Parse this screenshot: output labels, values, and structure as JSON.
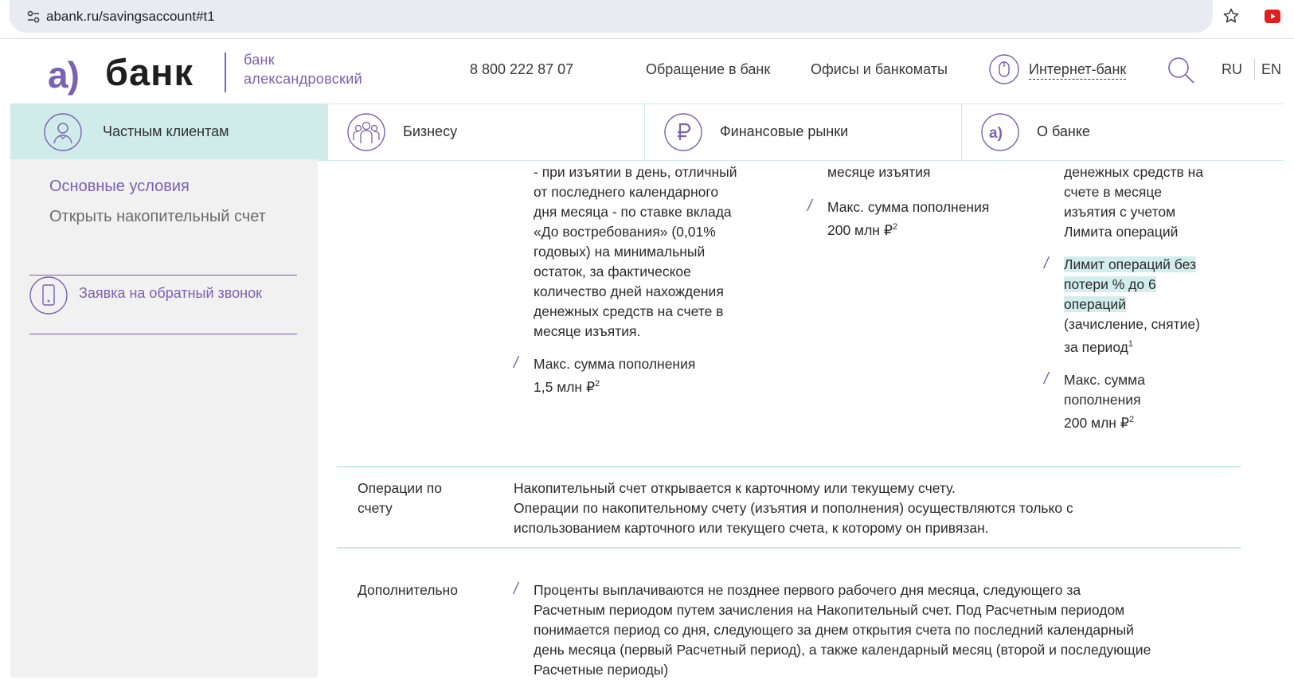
{
  "browser": {
    "url": "abank.ru/savingsaccount#t1"
  },
  "header": {
    "logo_mark": "а)",
    "logo_name": "банк",
    "logo_sub_1": "банк",
    "logo_sub_2": "александровский",
    "phone": "8 800 222 87 07",
    "nav": [
      "Обращение в банк",
      "Офисы и банкоматы"
    ],
    "internet_bank": "Интернет-банк",
    "lang_ru": "RU",
    "lang_en": "EN"
  },
  "sections": [
    {
      "label": "Частным клиентам",
      "icon": "person-icon",
      "active": true
    },
    {
      "label": "Бизнесу",
      "icon": "group-icon",
      "active": false
    },
    {
      "label": "Финансовые рынки",
      "icon": "ruble-icon",
      "active": false
    },
    {
      "label": "О банке",
      "icon": "bank-logo-icon",
      "active": false
    }
  ],
  "sidebar": {
    "links": [
      "Основные условия",
      "Открыть накопительный счет"
    ],
    "callback": "Заявка на обратный звонок"
  },
  "table": {
    "col1": {
      "lines": [
        "- при изъятии в день, отличный",
        "от последнего календарного",
        "дня месяца - по ставке вклада",
        "«До востребования» (0,01%",
        "годовых) на минимальный",
        "остаток, за фактическое",
        "количество дней нахождения",
        "денежных средств на счете в",
        "месяце изъятия."
      ],
      "max_label": "Макс. сумма пополнения",
      "max_value": "1,5 млн ₽",
      "max_sup": "2"
    },
    "col2": {
      "lines": [
        "месяце изъятия"
      ],
      "max_label": "Макс. сумма пополнения",
      "max_value": "200 млн ₽",
      "max_sup": "2"
    },
    "col3": {
      "lines": [
        "денежных средств на",
        "счете в месяце",
        "изъятия с учетом",
        "Лимита операций"
      ],
      "limit_lines": [
        " Лимит операций без",
        "потери % до 6",
        "операций"
      ],
      "limit_rest": [
        "(зачисление, снятие)",
        "за период"
      ],
      "limit_sup": "1",
      "max_label_1": "Макс. сумма",
      "max_label_2": "пополнения",
      "max_value": "200 млн ₽",
      "max_sup": "2"
    },
    "operations": {
      "label_1": "Операции по",
      "label_2": "счету",
      "lines": [
        "Накопительный счет открывается к карточному или текущему счету.",
        "Операции по накопительному счету (изъятия и пополнения) осуществляются только с",
        "использованием карточного или текущего счета, к которому он привязан."
      ]
    },
    "additional": {
      "label": "Дополнительно",
      "lines": [
        "Проценты выплачиваются не позднее первого рабочего дня месяца, следующего за",
        "Расчетным периодом путем зачисления на Накопительный счет. Под Расчетным периодом",
        "понимается период со дня, следующего за днем открытия счета по последний календарный",
        "день месяца (первый Расчетный период), а также календарный месяц (второй и последующие",
        "Расчетные периоды)"
      ]
    }
  },
  "colors": {
    "accent": "#7b61b0",
    "teal_light": "#cfecea",
    "teal_line": "#cde9e7",
    "sidebar_bg": "#f1f1f1"
  }
}
